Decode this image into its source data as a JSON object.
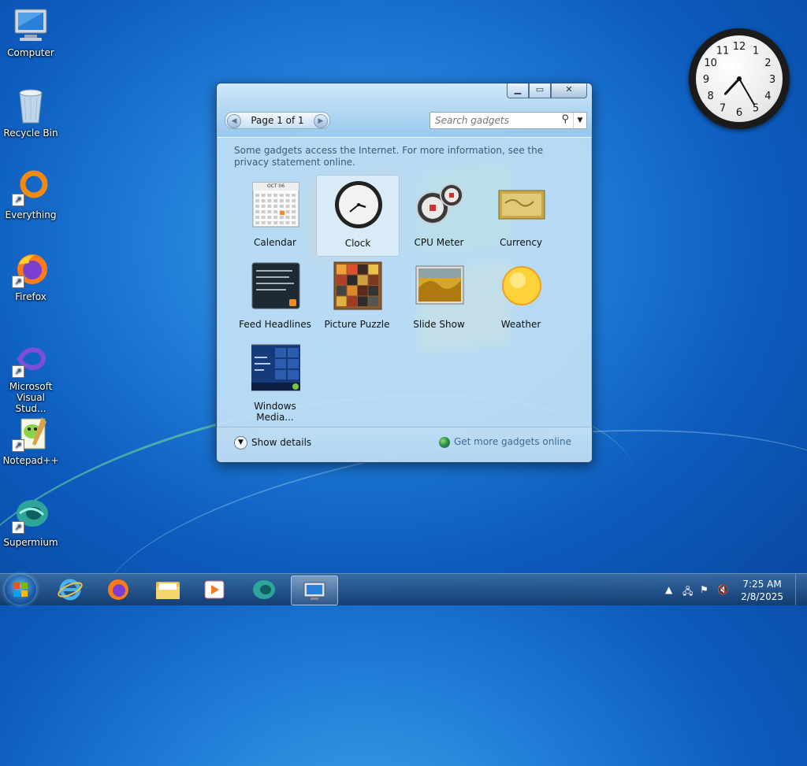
{
  "desktop": {
    "icons": [
      {
        "label": "Computer",
        "icon": "computer-icon"
      },
      {
        "label": "Recycle Bin",
        "icon": "recycle-bin-icon"
      },
      {
        "label": "Everything",
        "icon": "everything-icon"
      },
      {
        "label": "Firefox",
        "icon": "firefox-icon"
      },
      {
        "label": "Microsoft Visual Stud...",
        "icon": "visual-studio-icon"
      },
      {
        "label": "Notepad++",
        "icon": "notepad-plus-plus-icon"
      },
      {
        "label": "Supermium",
        "icon": "supermium-icon"
      }
    ],
    "clock_gadget": {
      "hour": 7,
      "minute": 25,
      "numerals": [
        "12",
        "1",
        "2",
        "3",
        "4",
        "5",
        "6",
        "7",
        "8",
        "9",
        "10",
        "11"
      ]
    }
  },
  "gadgets_window": {
    "pager": {
      "text": "Page 1 of 1"
    },
    "search": {
      "placeholder": "Search gadgets"
    },
    "notice": "Some gadgets access the Internet.  For more information, see the privacy statement online.",
    "gadgets": [
      {
        "label": "Calendar",
        "icon": "calendar-icon"
      },
      {
        "label": "Clock",
        "icon": "clock-icon",
        "selected": true
      },
      {
        "label": "CPU Meter",
        "icon": "cpu-meter-icon"
      },
      {
        "label": "Currency",
        "icon": "currency-icon"
      },
      {
        "label": "Feed Headlines",
        "icon": "feed-headlines-icon"
      },
      {
        "label": "Picture Puzzle",
        "icon": "picture-puzzle-icon"
      },
      {
        "label": "Slide Show",
        "icon": "slide-show-icon"
      },
      {
        "label": "Weather",
        "icon": "weather-icon"
      },
      {
        "label": "Windows Media...",
        "icon": "windows-media-icon"
      }
    ],
    "calendar_month": "OCT 06",
    "show_details": "Show details",
    "get_more": "Get more gadgets online"
  },
  "taskbar": {
    "pinned": [
      "internet-explorer-icon",
      "firefox-icon",
      "file-explorer-icon",
      "media-player-icon",
      "supermium-icon",
      "gadgets-icon"
    ],
    "time": "7:25 AM",
    "date": "2/8/2025"
  },
  "colors": {
    "desktop": "#1f7bd6",
    "window": "#add6f1",
    "taskbar": "#1c4f86"
  }
}
